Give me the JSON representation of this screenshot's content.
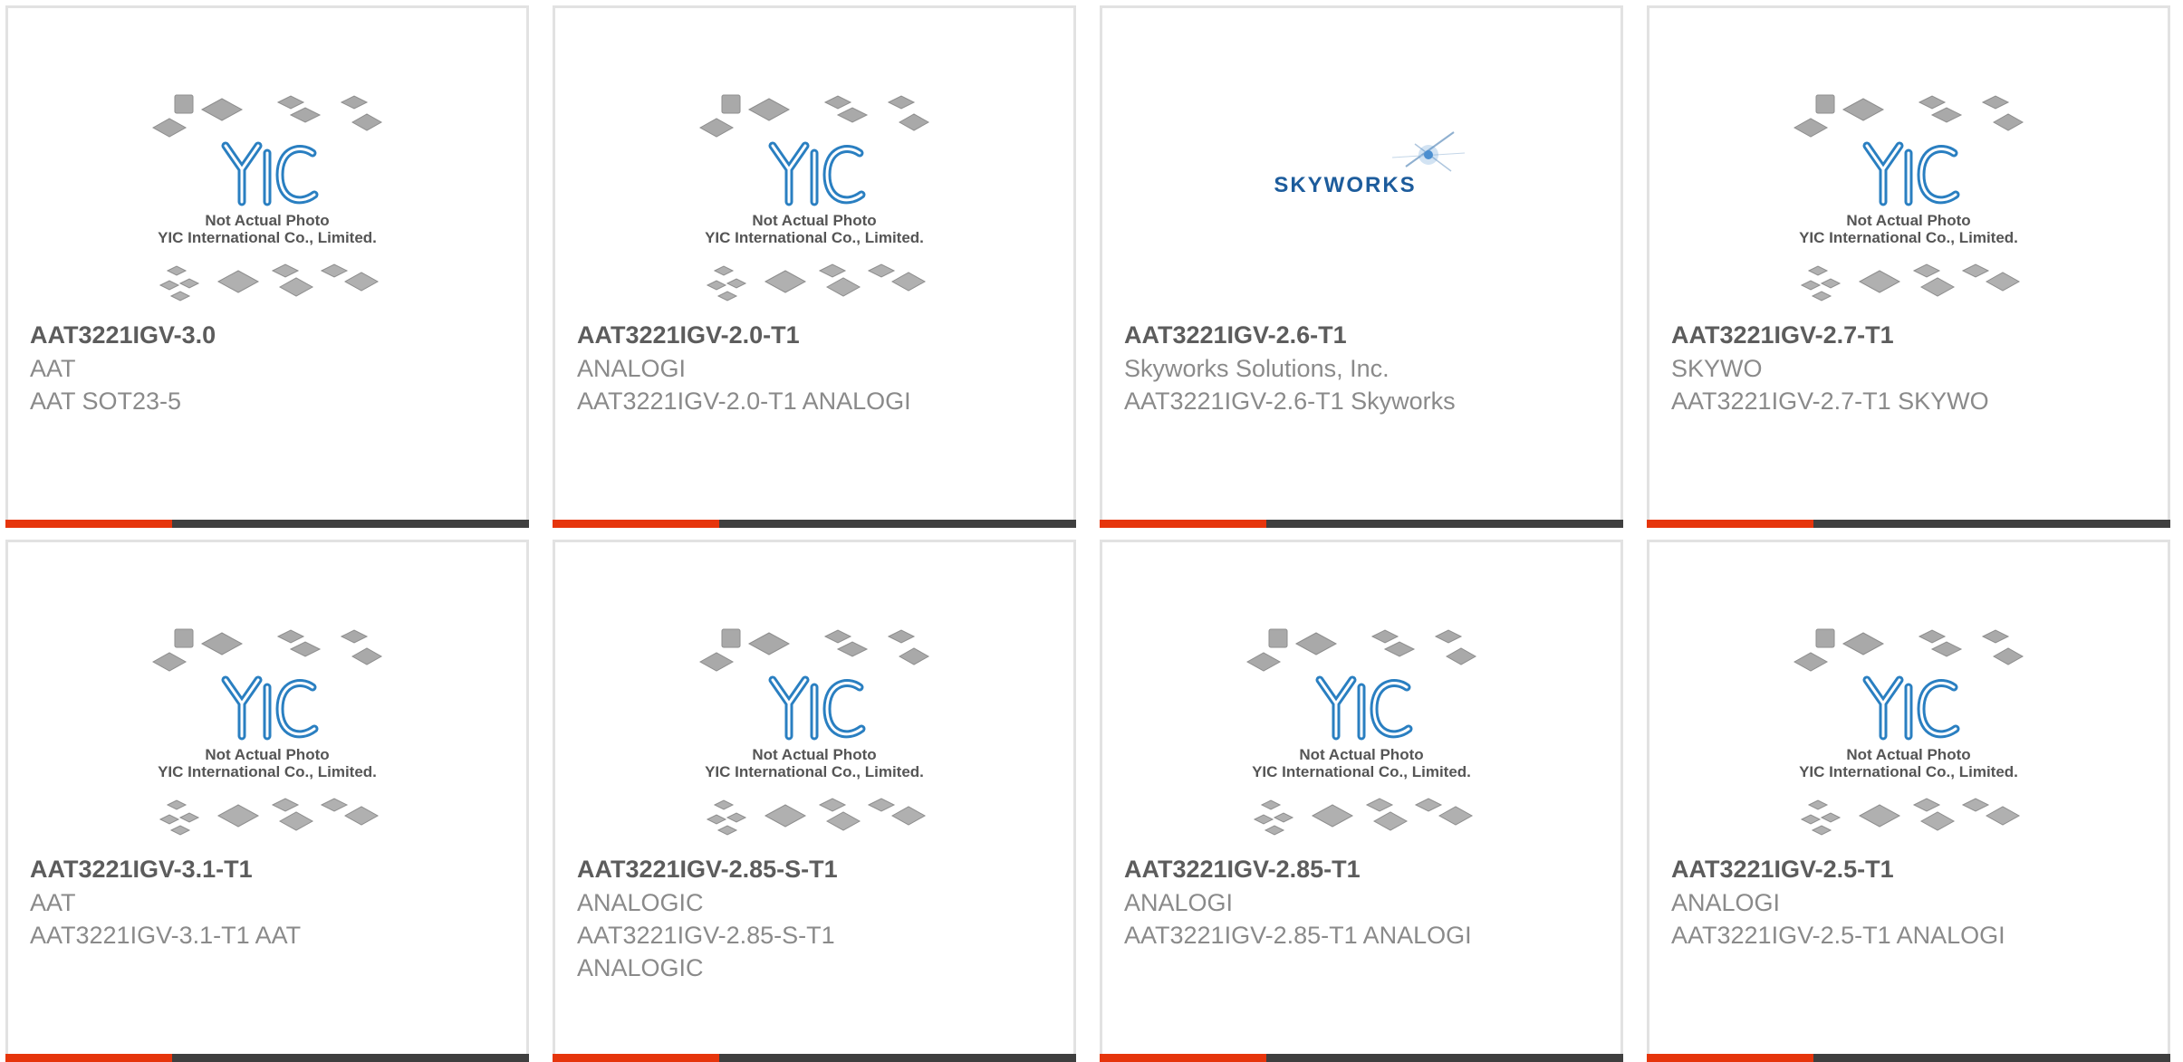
{
  "colors": {
    "accent": "#e6350c",
    "bar": "#3f3f3f",
    "title": "#5c5c5c",
    "text": "#8a8a8a",
    "yic_blue": "#2a7fc1",
    "skyworks_blue": "#1d5c9c"
  },
  "placeholder": {
    "line1": "Not Actual Photo",
    "line2": "YIC International Co., Limited."
  },
  "skyworks_logo": "SKYWORKS",
  "products": [
    {
      "part": "AAT3221IGV-3.0",
      "manufacturer": "AAT",
      "description": "AAT SOT23-5",
      "image": "yic-placeholder"
    },
    {
      "part": "AAT3221IGV-2.0-T1",
      "manufacturer": "ANALOGI",
      "description": "AAT3221IGV-2.0-T1 ANALOGI",
      "image": "yic-placeholder"
    },
    {
      "part": "AAT3221IGV-2.6-T1",
      "manufacturer": "Skyworks Solutions, Inc.",
      "description": "AAT3221IGV-2.6-T1 Skyworks",
      "image": "skyworks-logo"
    },
    {
      "part": "AAT3221IGV-2.7-T1",
      "manufacturer": "SKYWO",
      "description": "AAT3221IGV-2.7-T1 SKYWO",
      "image": "yic-placeholder"
    },
    {
      "part": "AAT3221IGV-3.1-T1",
      "manufacturer": "AAT",
      "description": "AAT3221IGV-3.1-T1 AAT",
      "image": "yic-placeholder"
    },
    {
      "part": "AAT3221IGV-2.85-S-T1",
      "manufacturer": "ANALOGIC",
      "description": "AAT3221IGV-2.85-S-T1 ANALOGIC",
      "image": "yic-placeholder"
    },
    {
      "part": "AAT3221IGV-2.85-T1",
      "manufacturer": "ANALOGI",
      "description": "AAT3221IGV-2.85-T1 ANALOGI",
      "image": "yic-placeholder"
    },
    {
      "part": "AAT3221IGV-2.5-T1",
      "manufacturer": "ANALOGI",
      "description": "AAT3221IGV-2.5-T1 ANALOGI",
      "image": "yic-placeholder"
    }
  ]
}
